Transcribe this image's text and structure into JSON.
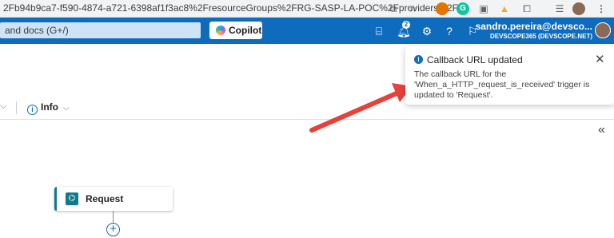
{
  "browser": {
    "url": "2Fb94b9ca7-f590-4874-a721-6398af1f3ac8%2FresourceGroups%2FRG-SASP-LA-POC%2Fproviders%2F...",
    "icons": [
      "share-icon",
      "star-icon",
      "extension-icon",
      "grammarly-icon",
      "extension-icon",
      "extension-icon",
      "puzzle-icon",
      "reading-list-icon",
      "profile-icon",
      "more-icon"
    ]
  },
  "header": {
    "search_placeholder": "and docs (G+/)",
    "copilot_label": "Copilot",
    "notification_count": "2",
    "user_name": "sandro.pereira@devsco...",
    "user_tenant": "DEVSCOPE365 (DEVSCOPE.NET)",
    "icons": [
      "cloud-shell-icon",
      "notifications-icon",
      "settings-icon",
      "help-icon",
      "feedback-icon"
    ]
  },
  "toolbar": {
    "info_label": "Info"
  },
  "designer": {
    "trigger_label": "Request"
  },
  "toast": {
    "title": "Callback URL updated",
    "body": "The callback URL for the 'When_a_HTTP_request_is_received' trigger is updated to 'Request'."
  },
  "colors": {
    "accent": "#0f6cbd",
    "trigger": "#0f7b8a",
    "arrow": "#e8403a"
  }
}
